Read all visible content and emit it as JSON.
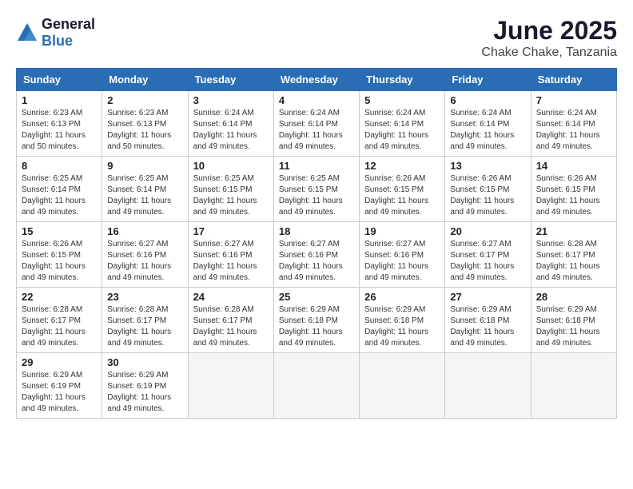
{
  "header": {
    "logo_general": "General",
    "logo_blue": "Blue",
    "month": "June 2025",
    "location": "Chake Chake, Tanzania"
  },
  "weekdays": [
    "Sunday",
    "Monday",
    "Tuesday",
    "Wednesday",
    "Thursday",
    "Friday",
    "Saturday"
  ],
  "weeks": [
    [
      {
        "day": "1",
        "sunrise": "6:23 AM",
        "sunset": "6:13 PM",
        "daylight": "11 hours and 50 minutes."
      },
      {
        "day": "2",
        "sunrise": "6:23 AM",
        "sunset": "6:13 PM",
        "daylight": "11 hours and 50 minutes."
      },
      {
        "day": "3",
        "sunrise": "6:24 AM",
        "sunset": "6:14 PM",
        "daylight": "11 hours and 49 minutes."
      },
      {
        "day": "4",
        "sunrise": "6:24 AM",
        "sunset": "6:14 PM",
        "daylight": "11 hours and 49 minutes."
      },
      {
        "day": "5",
        "sunrise": "6:24 AM",
        "sunset": "6:14 PM",
        "daylight": "11 hours and 49 minutes."
      },
      {
        "day": "6",
        "sunrise": "6:24 AM",
        "sunset": "6:14 PM",
        "daylight": "11 hours and 49 minutes."
      },
      {
        "day": "7",
        "sunrise": "6:24 AM",
        "sunset": "6:14 PM",
        "daylight": "11 hours and 49 minutes."
      }
    ],
    [
      {
        "day": "8",
        "sunrise": "6:25 AM",
        "sunset": "6:14 PM",
        "daylight": "11 hours and 49 minutes."
      },
      {
        "day": "9",
        "sunrise": "6:25 AM",
        "sunset": "6:14 PM",
        "daylight": "11 hours and 49 minutes."
      },
      {
        "day": "10",
        "sunrise": "6:25 AM",
        "sunset": "6:15 PM",
        "daylight": "11 hours and 49 minutes."
      },
      {
        "day": "11",
        "sunrise": "6:25 AM",
        "sunset": "6:15 PM",
        "daylight": "11 hours and 49 minutes."
      },
      {
        "day": "12",
        "sunrise": "6:26 AM",
        "sunset": "6:15 PM",
        "daylight": "11 hours and 49 minutes."
      },
      {
        "day": "13",
        "sunrise": "6:26 AM",
        "sunset": "6:15 PM",
        "daylight": "11 hours and 49 minutes."
      },
      {
        "day": "14",
        "sunrise": "6:26 AM",
        "sunset": "6:15 PM",
        "daylight": "11 hours and 49 minutes."
      }
    ],
    [
      {
        "day": "15",
        "sunrise": "6:26 AM",
        "sunset": "6:15 PM",
        "daylight": "11 hours and 49 minutes."
      },
      {
        "day": "16",
        "sunrise": "6:27 AM",
        "sunset": "6:16 PM",
        "daylight": "11 hours and 49 minutes."
      },
      {
        "day": "17",
        "sunrise": "6:27 AM",
        "sunset": "6:16 PM",
        "daylight": "11 hours and 49 minutes."
      },
      {
        "day": "18",
        "sunrise": "6:27 AM",
        "sunset": "6:16 PM",
        "daylight": "11 hours and 49 minutes."
      },
      {
        "day": "19",
        "sunrise": "6:27 AM",
        "sunset": "6:16 PM",
        "daylight": "11 hours and 49 minutes."
      },
      {
        "day": "20",
        "sunrise": "6:27 AM",
        "sunset": "6:17 PM",
        "daylight": "11 hours and 49 minutes."
      },
      {
        "day": "21",
        "sunrise": "6:28 AM",
        "sunset": "6:17 PM",
        "daylight": "11 hours and 49 minutes."
      }
    ],
    [
      {
        "day": "22",
        "sunrise": "6:28 AM",
        "sunset": "6:17 PM",
        "daylight": "11 hours and 49 minutes."
      },
      {
        "day": "23",
        "sunrise": "6:28 AM",
        "sunset": "6:17 PM",
        "daylight": "11 hours and 49 minutes."
      },
      {
        "day": "24",
        "sunrise": "6:28 AM",
        "sunset": "6:17 PM",
        "daylight": "11 hours and 49 minutes."
      },
      {
        "day": "25",
        "sunrise": "6:29 AM",
        "sunset": "6:18 PM",
        "daylight": "11 hours and 49 minutes."
      },
      {
        "day": "26",
        "sunrise": "6:29 AM",
        "sunset": "6:18 PM",
        "daylight": "11 hours and 49 minutes."
      },
      {
        "day": "27",
        "sunrise": "6:29 AM",
        "sunset": "6:18 PM",
        "daylight": "11 hours and 49 minutes."
      },
      {
        "day": "28",
        "sunrise": "6:29 AM",
        "sunset": "6:18 PM",
        "daylight": "11 hours and 49 minutes."
      }
    ],
    [
      {
        "day": "29",
        "sunrise": "6:29 AM",
        "sunset": "6:19 PM",
        "daylight": "11 hours and 49 minutes."
      },
      {
        "day": "30",
        "sunrise": "6:29 AM",
        "sunset": "6:19 PM",
        "daylight": "11 hours and 49 minutes."
      },
      null,
      null,
      null,
      null,
      null
    ]
  ]
}
